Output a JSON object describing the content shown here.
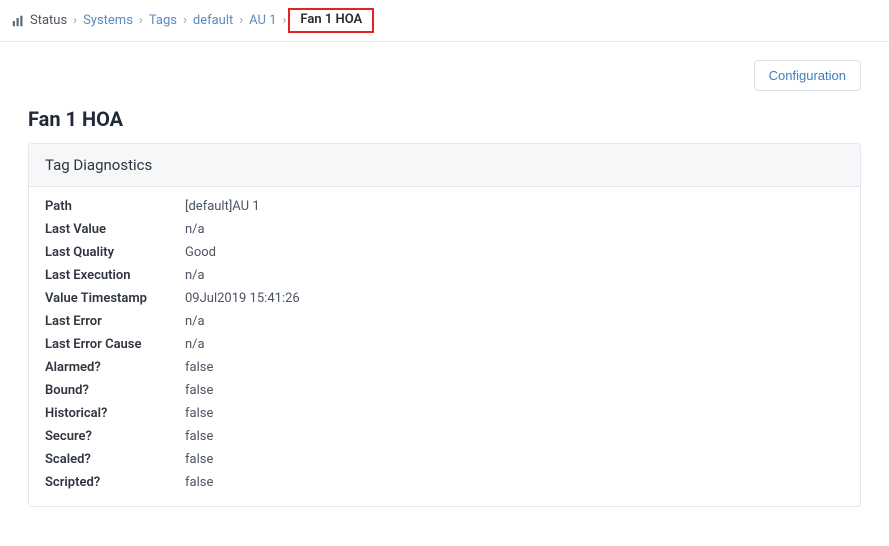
{
  "breadcrumb": {
    "root_icon": "bar-chart",
    "items": [
      {
        "label": "Status",
        "link": false
      },
      {
        "label": "Systems",
        "link": true
      },
      {
        "label": "Tags",
        "link": true
      },
      {
        "label": "default",
        "link": true
      },
      {
        "label": "AU 1",
        "link": true
      },
      {
        "label": "Fan 1 HOA",
        "link": false,
        "active": true,
        "highlighted": true
      }
    ]
  },
  "actions": {
    "configuration": "Configuration"
  },
  "page": {
    "title": "Fan 1 HOA"
  },
  "panel": {
    "title": "Tag Diagnostics",
    "rows": [
      {
        "label": "Path",
        "value": "[default]AU 1"
      },
      {
        "label": "Last Value",
        "value": "n/a"
      },
      {
        "label": "Last Quality",
        "value": "Good"
      },
      {
        "label": "Last Execution",
        "value": "n/a"
      },
      {
        "label": "Value Timestamp",
        "value": "09Jul2019 15:41:26"
      },
      {
        "label": "Last Error",
        "value": "n/a"
      },
      {
        "label": "Last Error Cause",
        "value": "n/a"
      },
      {
        "label": "Alarmed?",
        "value": "false"
      },
      {
        "label": "Bound?",
        "value": "false"
      },
      {
        "label": "Historical?",
        "value": "false"
      },
      {
        "label": "Secure?",
        "value": "false"
      },
      {
        "label": "Scaled?",
        "value": "false"
      },
      {
        "label": "Scripted?",
        "value": "false"
      }
    ]
  }
}
